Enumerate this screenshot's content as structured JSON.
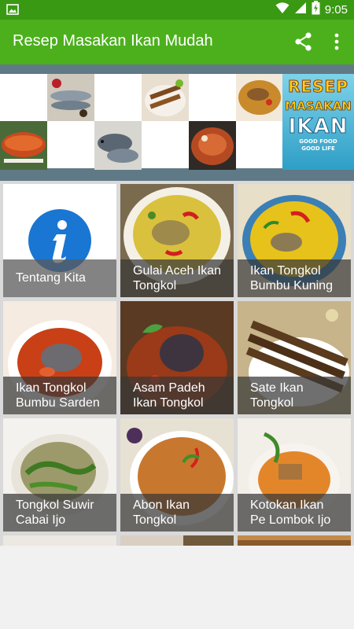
{
  "status_bar": {
    "time": "9:05",
    "icons": [
      "image-notification-icon",
      "wifi-icon",
      "signal-icon",
      "battery-charging-icon"
    ]
  },
  "app_bar": {
    "title": "Resep Masakan Ikan Mudah",
    "actions": [
      "share-icon",
      "more-vert-icon"
    ]
  },
  "banner": {
    "brand_line1": "RESEP",
    "brand_line2": "MASAKAN",
    "brand_line3": "IKAN",
    "brand_tag1": "GOOD FOOD",
    "brand_tag2": "GOOD LIFE"
  },
  "menu": {
    "items": [
      {
        "label": "Tentang Kita",
        "icon": "info-icon"
      },
      {
        "label": "Gulai Aceh Ikan\nTongkol"
      },
      {
        "label": "Ikan Tongkol\nBumbu Kuning"
      },
      {
        "label": "Ikan Tongkol\nBumbu Sarden"
      },
      {
        "label": "Asam Padeh\nIkan Tongkol"
      },
      {
        "label": "Sate Ikan\nTongkol"
      },
      {
        "label": "Tongkol Suwir\nCabai Ijo"
      },
      {
        "label": "Abon Ikan\nTongkol"
      },
      {
        "label": "Kotokan Ikan\nPe Lombok Ijo"
      }
    ]
  },
  "colors": {
    "status_bar": "#3a9913",
    "app_bar": "#4cb01d",
    "info_blue": "#1976d2"
  }
}
